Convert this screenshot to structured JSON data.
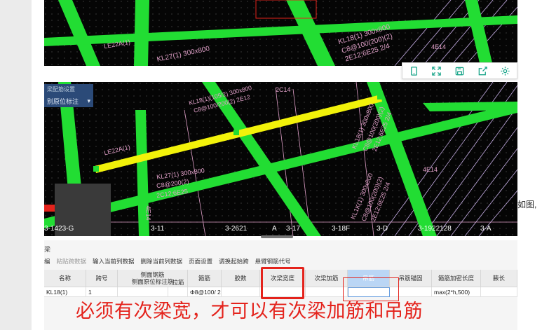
{
  "colors": {
    "cad_bg": "#050505",
    "beam_green": "#22dd33",
    "beam_yellow": "#f2f20a",
    "label_pink": "#e0a0c8",
    "accent_red": "#e4231c",
    "selected_header": "#bad6f5"
  },
  "toolbar_icons": [
    "tablet-icon",
    "expand-icon",
    "save-icon",
    "share-icon",
    "settings-icon"
  ],
  "cad_top": {
    "labels": [
      "KL18(1) 300x800",
      "C8@100(200)(2)",
      "2E12;6E25 2/4",
      "KL27(1) 300x800",
      "LE22A(1)",
      "4E14"
    ]
  },
  "cad_bottom": {
    "labels": [
      "KL18(1)(105/2) 300x800",
      "C8@100/200(2) 2E12",
      "2C14",
      "KL18(1) 300x800",
      "C8@100(200)(2)",
      "2E12;6E25 2/4",
      "KL27(1) 300x800",
      "C8@200(2)",
      "2C12;6E25",
      "LE22A(1)",
      "KL1K(1) 300x800",
      "C8@100(200)(2)",
      "2E12;6E25 2/4",
      "4E14",
      "4E14"
    ],
    "axis_labels": [
      "3-1423-G",
      "3-11",
      "3-2621",
      "A",
      "3-17",
      "3-18F",
      "3-D",
      "3-1922128",
      "3-A"
    ]
  },
  "dropdown": {
    "top_label": "梁配筋设置",
    "value": "别原位标注"
  },
  "side_text": "如图,",
  "panel": {
    "title": "梁",
    "toolbar": [
      "编",
      "粘贴跨数据",
      "输入当前列数据",
      "删除当前列数据",
      "页面设置",
      "调换起始跨",
      "悬臂钢筋代号"
    ],
    "headers": [
      "名称",
      "跨号",
      "侧面钢筋",
      "侧面原位标注筋",
      "拉筋",
      "箍筋",
      "胶数",
      "次梁宽度",
      "次梁加筋",
      "吊筋",
      "吊筋锚固",
      "箍筋加密长度",
      "腋长"
    ],
    "row": [
      "KL18(1)",
      "1",
      "",
      "",
      "Φ8@100/ 2",
      "",
      "",
      "",
      "",
      "",
      "max(2*h,500)",
      ""
    ]
  },
  "caption": "必须有次梁宽，才可以有次梁加筋和吊筋"
}
